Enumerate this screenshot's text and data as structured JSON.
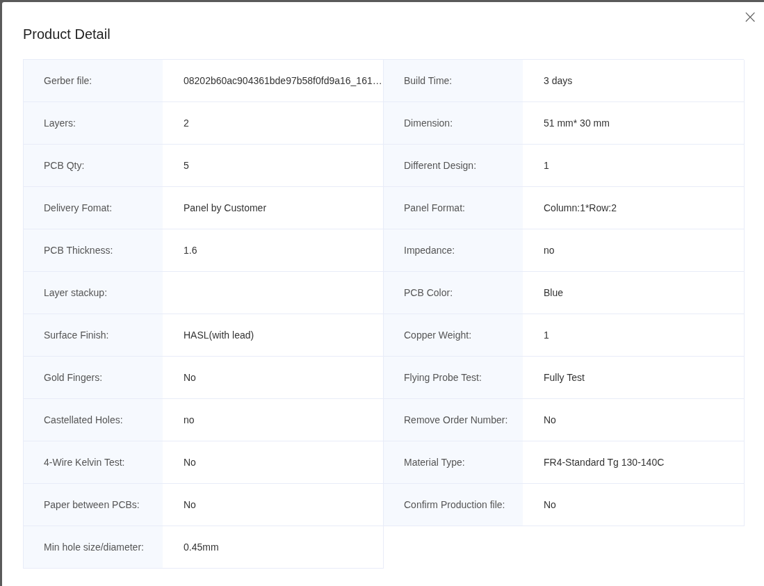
{
  "dialog": {
    "title": "Product Detail",
    "close": "×"
  },
  "fields": [
    {
      "label": "Gerber file:",
      "value": "08202b60ac904361bde97b58f0fd9a16_161…"
    },
    {
      "label": "Build Time:",
      "value": "3 days"
    },
    {
      "label": "Layers:",
      "value": "2"
    },
    {
      "label": "Dimension:",
      "value": "51 mm* 30 mm"
    },
    {
      "label": "PCB Qty:",
      "value": "5"
    },
    {
      "label": "Different Design:",
      "value": "1"
    },
    {
      "label": "Delivery Fomat:",
      "value": "Panel by Customer"
    },
    {
      "label": "Panel Format:",
      "value": "Column:1*Row:2"
    },
    {
      "label": "PCB Thickness:",
      "value": "1.6"
    },
    {
      "label": "Impedance:",
      "value": "no"
    },
    {
      "label": "Layer stackup:"
    },
    {
      "label": "PCB Color:",
      "value": "Blue"
    },
    {
      "label": "Surface Finish:",
      "value": "HASL(with lead)"
    },
    {
      "label": "Copper Weight:",
      "value": "1"
    },
    {
      "label": "Gold Fingers:",
      "value": "No"
    },
    {
      "label": "Flying Probe Test:",
      "value": "Fully Test"
    },
    {
      "label": "Castellated Holes:",
      "value": "no"
    },
    {
      "label": "Remove Order Number:",
      "value": "No"
    },
    {
      "label": "4-Wire Kelvin Test:",
      "value": "No"
    },
    {
      "label": "Material Type:",
      "value": "FR4-Standard Tg 130-140C"
    },
    {
      "label": "Paper between PCBs:",
      "value": "No"
    },
    {
      "label": "Confirm Production file:",
      "value": "No"
    },
    {
      "label": "Min hole size/diameter:",
      "value": "0.45mm"
    }
  ]
}
